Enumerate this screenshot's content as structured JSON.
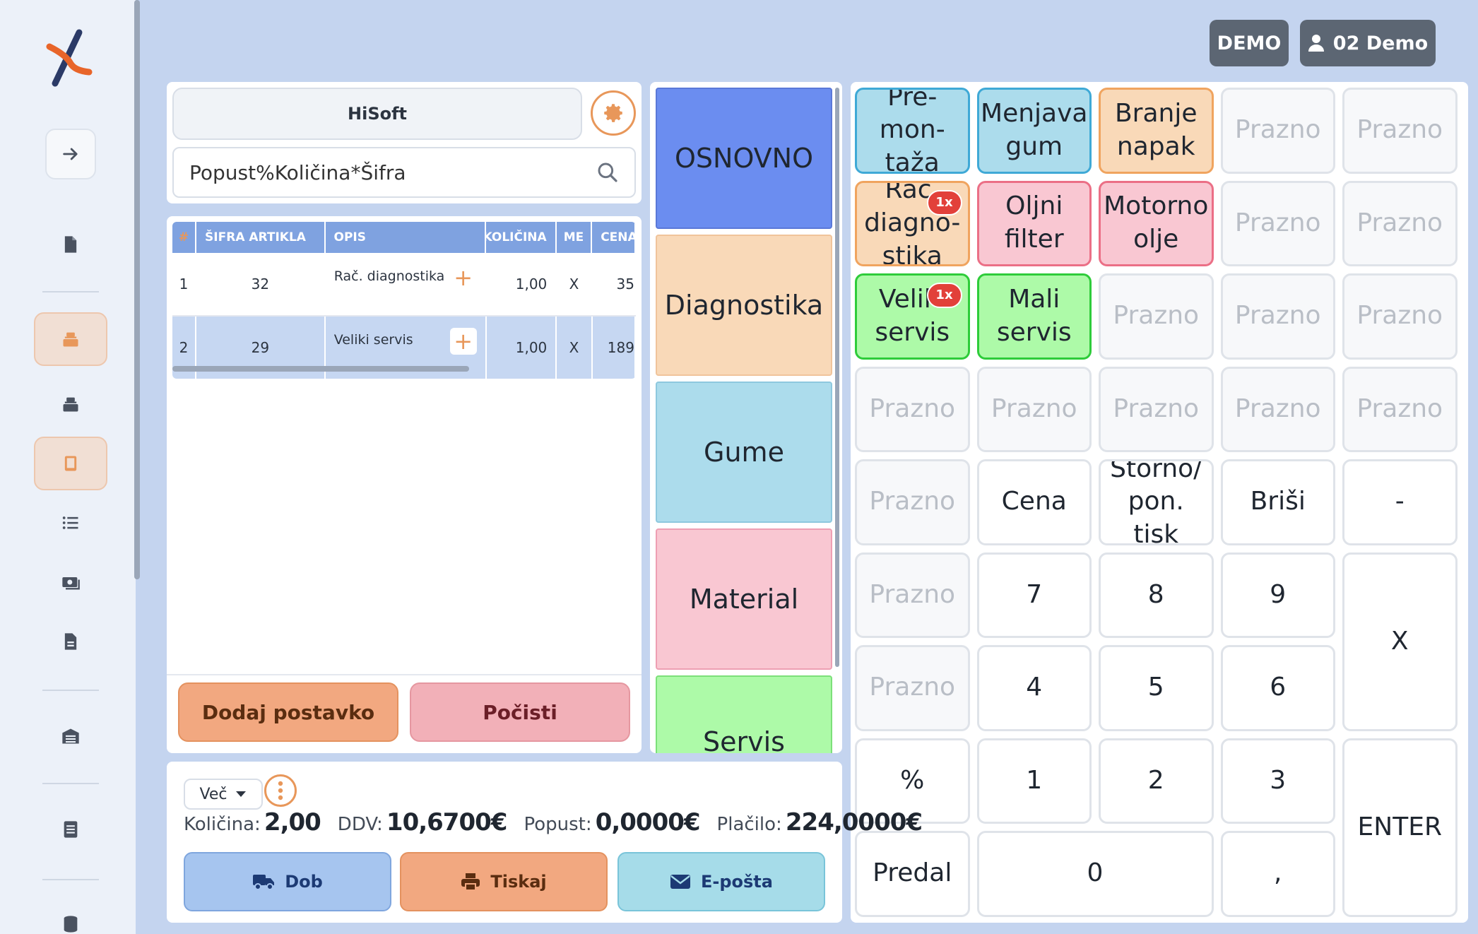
{
  "header": {
    "demo_label": "DEMO",
    "user_label": "02 Demo"
  },
  "search": {
    "company_label": "HiSoft",
    "placeholder": "Popust%Količina*Šifra"
  },
  "table": {
    "columns": [
      "#",
      "ŠIFRA ARTIKLA",
      "OPIS",
      "KOLIČINA",
      "ME",
      "CENA"
    ],
    "rows": [
      {
        "num": "1",
        "code": "32",
        "desc": "Rač. diagnostika",
        "qty": "1,00",
        "unit": "X",
        "price": "35"
      },
      {
        "num": "2",
        "code": "29",
        "desc": "Veliki servis",
        "qty": "1,00",
        "unit": "X",
        "price": "189"
      }
    ]
  },
  "actions": {
    "add_label": "Dodaj postavko",
    "clear_label": "Počisti"
  },
  "categories": [
    {
      "label": "OSNOVNO"
    },
    {
      "label": "Diagnostika"
    },
    {
      "label": "Gume"
    },
    {
      "label": "Material"
    },
    {
      "label": "Servis"
    }
  ],
  "keypad": {
    "keys": [
      {
        "label": "Pre-\nmon-\ntaža"
      },
      {
        "label": "Menjava\ngum"
      },
      {
        "label": "Branje\nnapak"
      },
      {
        "label": "Prazno"
      },
      {
        "label": "Prazno"
      },
      {
        "label": "Rač.\ndiagno-\nstika",
        "badge": "1x"
      },
      {
        "label": "Oljni\nfilter"
      },
      {
        "label": "Motorno\nolje"
      },
      {
        "label": "Prazno"
      },
      {
        "label": "Prazno"
      },
      {
        "label": "Veliki\nservis",
        "badge": "1x"
      },
      {
        "label": "Mali\nservis"
      },
      {
        "label": "Prazno"
      },
      {
        "label": "Prazno"
      },
      {
        "label": "Prazno"
      },
      {
        "label": "Prazno"
      },
      {
        "label": "Prazno"
      },
      {
        "label": "Prazno"
      },
      {
        "label": "Prazno"
      },
      {
        "label": "Prazno"
      },
      {
        "label": "Prazno"
      },
      {
        "label": "Cena"
      },
      {
        "label": "Storno/\npon.\ntisk"
      },
      {
        "label": "Briši"
      },
      {
        "label": "-"
      },
      {
        "label": "Prazno"
      },
      {
        "label": "7"
      },
      {
        "label": "8"
      },
      {
        "label": "9"
      },
      {
        "label": "X"
      },
      {
        "label": "Prazno"
      },
      {
        "label": "4"
      },
      {
        "label": "5"
      },
      {
        "label": "6"
      },
      {
        "label": "%"
      },
      {
        "label": "1"
      },
      {
        "label": "2"
      },
      {
        "label": "3"
      },
      {
        "label": "ENTER"
      },
      {
        "label": "Predal"
      },
      {
        "label": "0"
      },
      {
        "label": ","
      }
    ]
  },
  "summary": {
    "more_label": "Več",
    "qty_label": "Količina:",
    "qty_value": "2,00",
    "vat_label": "DDV:",
    "vat_value": "10,6700€",
    "discount_label": "Popust:",
    "discount_value": "0,0000€",
    "paid_label": "Plačilo:",
    "paid_value": "224,0000€",
    "dob_label": "Dob",
    "print_label": "Tiskaj",
    "email_label": "E-pošta"
  },
  "colors": {
    "accent": "#e8975a",
    "header_blue": "#7fa2e0",
    "badge_red": "#e2403a"
  }
}
